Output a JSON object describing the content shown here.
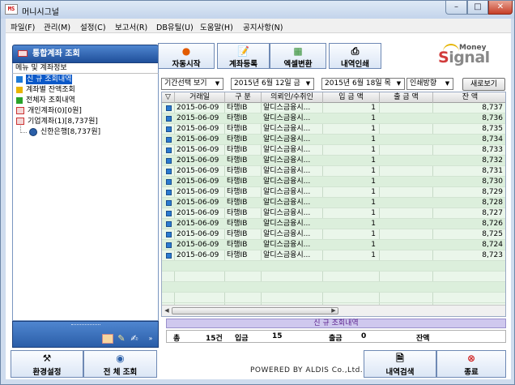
{
  "window": {
    "title": "머니시그널",
    "app_icon": "MS",
    "min": "–",
    "max": "□",
    "close": "✕"
  },
  "menu": [
    "파일(F)",
    "관리(M)",
    "설정(C)",
    "보고서(R)",
    "DB유틸(U)",
    "도움말(H)",
    "공지사항(N)"
  ],
  "left_panel": {
    "header": "통합계좌 조회",
    "subheader": "메뉴 및 계좌정보",
    "tree": [
      {
        "label": "신  규 조회내역",
        "color": "#1f7ad6",
        "selected": true
      },
      {
        "label": "계좌별 잔액조회",
        "color": "#e8b400"
      },
      {
        "label": "전체자 조회내역",
        "color": "#2aa32a"
      },
      {
        "label": "개인계좌(0)[0원]",
        "color": "#d04040"
      },
      {
        "label": "기업계좌(1)[8,737원]",
        "color": "#d04040"
      },
      {
        "label": "신한은행[8,737원]",
        "color": "#2a5fa8"
      }
    ]
  },
  "bottom_buttons": {
    "settings": "환경설정",
    "full_view": "전 체 조회",
    "search": "내역검색",
    "exit": "종료"
  },
  "toolbar": {
    "auto_start": "자동시작",
    "account_reg": "계좌등록",
    "excel_export": "엑셀변환",
    "print": "내역인쇄"
  },
  "logo": {
    "top": "Money",
    "main_prefix": "S",
    "main_rest": "ignal"
  },
  "filters": {
    "period": "기간선택 보기",
    "date_from": "2015년  6월 12일 금",
    "date_to": "2015년  6월 18일 목",
    "print_dir": "인쇄방향",
    "refresh": "새로보기"
  },
  "table": {
    "columns": [
      "▽",
      "거래일",
      "구  분",
      "의뢰인/수취인",
      "입 금 액",
      "출 금 액",
      "잔  액"
    ],
    "rows": [
      [
        "2015-06-09",
        "타행IB",
        "알디스금융시...",
        "1",
        "",
        "8,737"
      ],
      [
        "2015-06-09",
        "타행IB",
        "알디스금융시...",
        "1",
        "",
        "8,736"
      ],
      [
        "2015-06-09",
        "타행IB",
        "알디스금융시...",
        "1",
        "",
        "8,735"
      ],
      [
        "2015-06-09",
        "타행IB",
        "알디스금융시...",
        "1",
        "",
        "8,734"
      ],
      [
        "2015-06-09",
        "타행IB",
        "알디스금융시...",
        "1",
        "",
        "8,733"
      ],
      [
        "2015-06-09",
        "타행IB",
        "알디스금융시...",
        "1",
        "",
        "8,732"
      ],
      [
        "2015-06-09",
        "타행IB",
        "알디스금융시...",
        "1",
        "",
        "8,731"
      ],
      [
        "2015-06-09",
        "타행IB",
        "알디스금융시...",
        "1",
        "",
        "8,730"
      ],
      [
        "2015-06-09",
        "타행IB",
        "알디스금융시...",
        "1",
        "",
        "8,729"
      ],
      [
        "2015-06-09",
        "타행IB",
        "알디스금융시...",
        "1",
        "",
        "8,728"
      ],
      [
        "2015-06-09",
        "타행IB",
        "알디스금융시...",
        "1",
        "",
        "8,727"
      ],
      [
        "2015-06-09",
        "타행IB",
        "알디스금융시...",
        "1",
        "",
        "8,726"
      ],
      [
        "2015-06-09",
        "타행IB",
        "알디스금융시...",
        "1",
        "",
        "8,725"
      ],
      [
        "2015-06-09",
        "타행IB",
        "알디스금융시...",
        "1",
        "",
        "8,724"
      ],
      [
        "2015-06-09",
        "타행IB",
        "알디스금융시...",
        "1",
        "",
        "8,723"
      ]
    ]
  },
  "caption": "신  규 조회내역",
  "summary": {
    "total_label": "총",
    "total_value": "15건",
    "deposit_label": "입금",
    "deposit_value": "15",
    "withdraw_label": "출금",
    "withdraw_value": "0",
    "balance_label": "잔액"
  },
  "footer": "POWERED BY ALDIS Co.,Ltd."
}
